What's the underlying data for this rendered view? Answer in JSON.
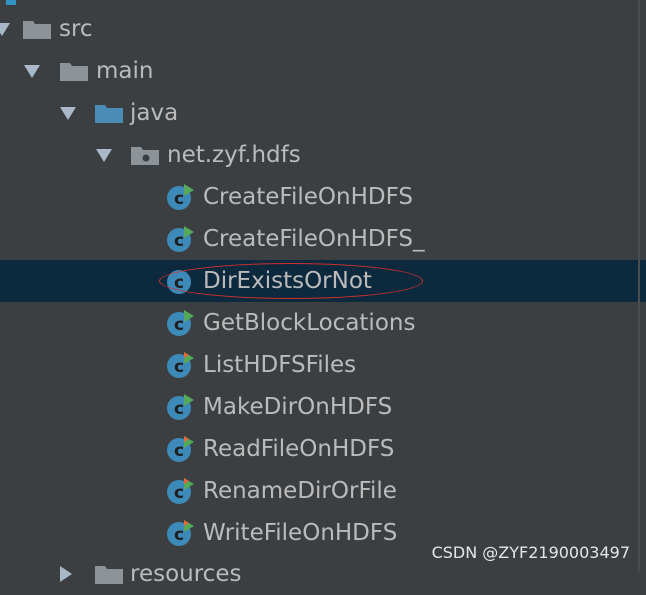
{
  "tree": {
    "src": {
      "label": "src",
      "icon": "folder-icon"
    },
    "main": {
      "label": "main",
      "icon": "folder-icon"
    },
    "java": {
      "label": "java",
      "icon": "source-folder-icon"
    },
    "package": {
      "label": "net.zyf.hdfs",
      "icon": "package-icon"
    },
    "classes": [
      {
        "label": "CreateFileOnHDFS",
        "icon": "runnable-class-icon"
      },
      {
        "label": "CreateFileOnHDFS_",
        "icon": "runnable-class-icon"
      },
      {
        "label": "DirExistsOrNot",
        "icon": "class-icon",
        "selected": true
      },
      {
        "label": "GetBlockLocations",
        "icon": "runnable-class-icon"
      },
      {
        "label": "ListHDFSFiles",
        "icon": "runnable-class-with-error-icon"
      },
      {
        "label": "MakeDirOnHDFS",
        "icon": "runnable-class-icon"
      },
      {
        "label": "ReadFileOnHDFS",
        "icon": "runnable-class-with-error-icon"
      },
      {
        "label": "RenameDirOrFile",
        "icon": "runnable-class-with-error-icon"
      },
      {
        "label": "WriteFileOnHDFS",
        "icon": "runnable-class-with-error-icon"
      }
    ],
    "resources": {
      "label": "resources",
      "icon": "folder-icon"
    }
  },
  "colors": {
    "background": "#3c3f41",
    "selection": "#0d293e",
    "text": "#bbbbbb",
    "folder": "#8c949a",
    "source_folder": "#4a8cb5",
    "class_badge": "#3d8ab8",
    "run_marker": "#54a857",
    "error_marker": "#e2683c",
    "annotation_oval": "#d0312d"
  },
  "watermark": "CSDN @ZYF2190003497"
}
